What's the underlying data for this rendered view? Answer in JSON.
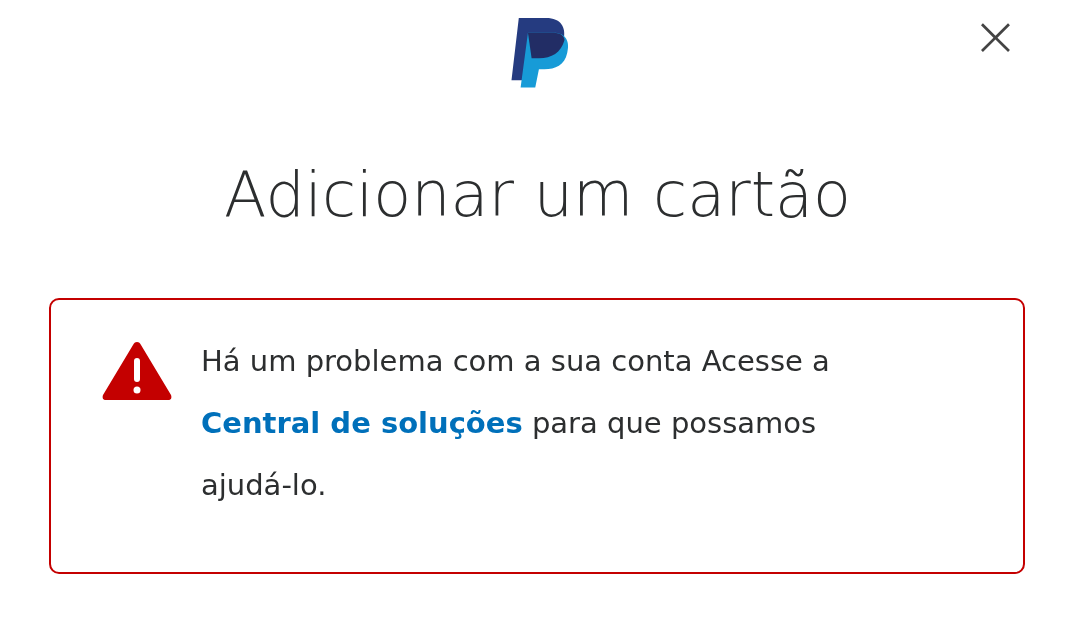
{
  "close": {
    "label": "×"
  },
  "title": "Adicionar um cartão",
  "alert": {
    "kind": "error",
    "text_before": "Há um problema com a sua conta Acesse a",
    "link": "Central de soluções",
    "text_after": "para que possamos ajudá-lo."
  }
}
